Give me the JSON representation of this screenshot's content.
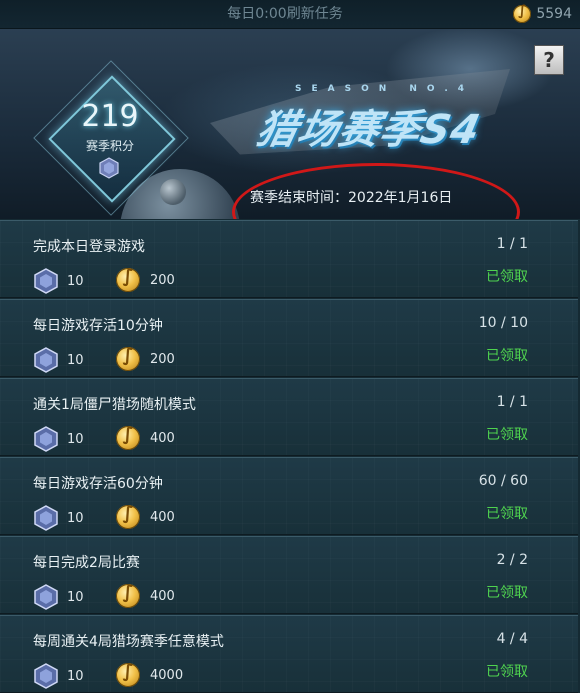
{
  "header": {
    "refresh_label": "每日0:00刷新任务",
    "coin_count": "5594"
  },
  "banner": {
    "help_label": "?",
    "score_value": "219",
    "score_label": "赛季积分",
    "season_no": "SEASON NO.4",
    "title": "猎场赛季S4",
    "end_time": "赛季结束时间：2022年1月16日"
  },
  "tasks": [
    {
      "name": "完成本日登录游戏",
      "progress": "1 / 1",
      "reward_points": "10",
      "reward_coins": "200",
      "status": "已领取"
    },
    {
      "name": "每日游戏存活10分钟",
      "progress": "10 / 10",
      "reward_points": "10",
      "reward_coins": "200",
      "status": "已领取"
    },
    {
      "name": "通关1局僵尸猎场随机模式",
      "progress": "1 / 1",
      "reward_points": "10",
      "reward_coins": "400",
      "status": "已领取"
    },
    {
      "name": "每日游戏存活60分钟",
      "progress": "60 / 60",
      "reward_points": "10",
      "reward_coins": "400",
      "status": "已领取"
    },
    {
      "name": "每日完成2局比赛",
      "progress": "2 / 2",
      "reward_points": "10",
      "reward_coins": "400",
      "status": "已领取"
    },
    {
      "name": "每周通关4局猎场赛季任意模式",
      "progress": "4 / 4",
      "reward_points": "10",
      "reward_coins": "4000",
      "status": "已领取"
    }
  ],
  "colors": {
    "claimed": "#4fd34f",
    "highlight_oval": "#d01818"
  }
}
